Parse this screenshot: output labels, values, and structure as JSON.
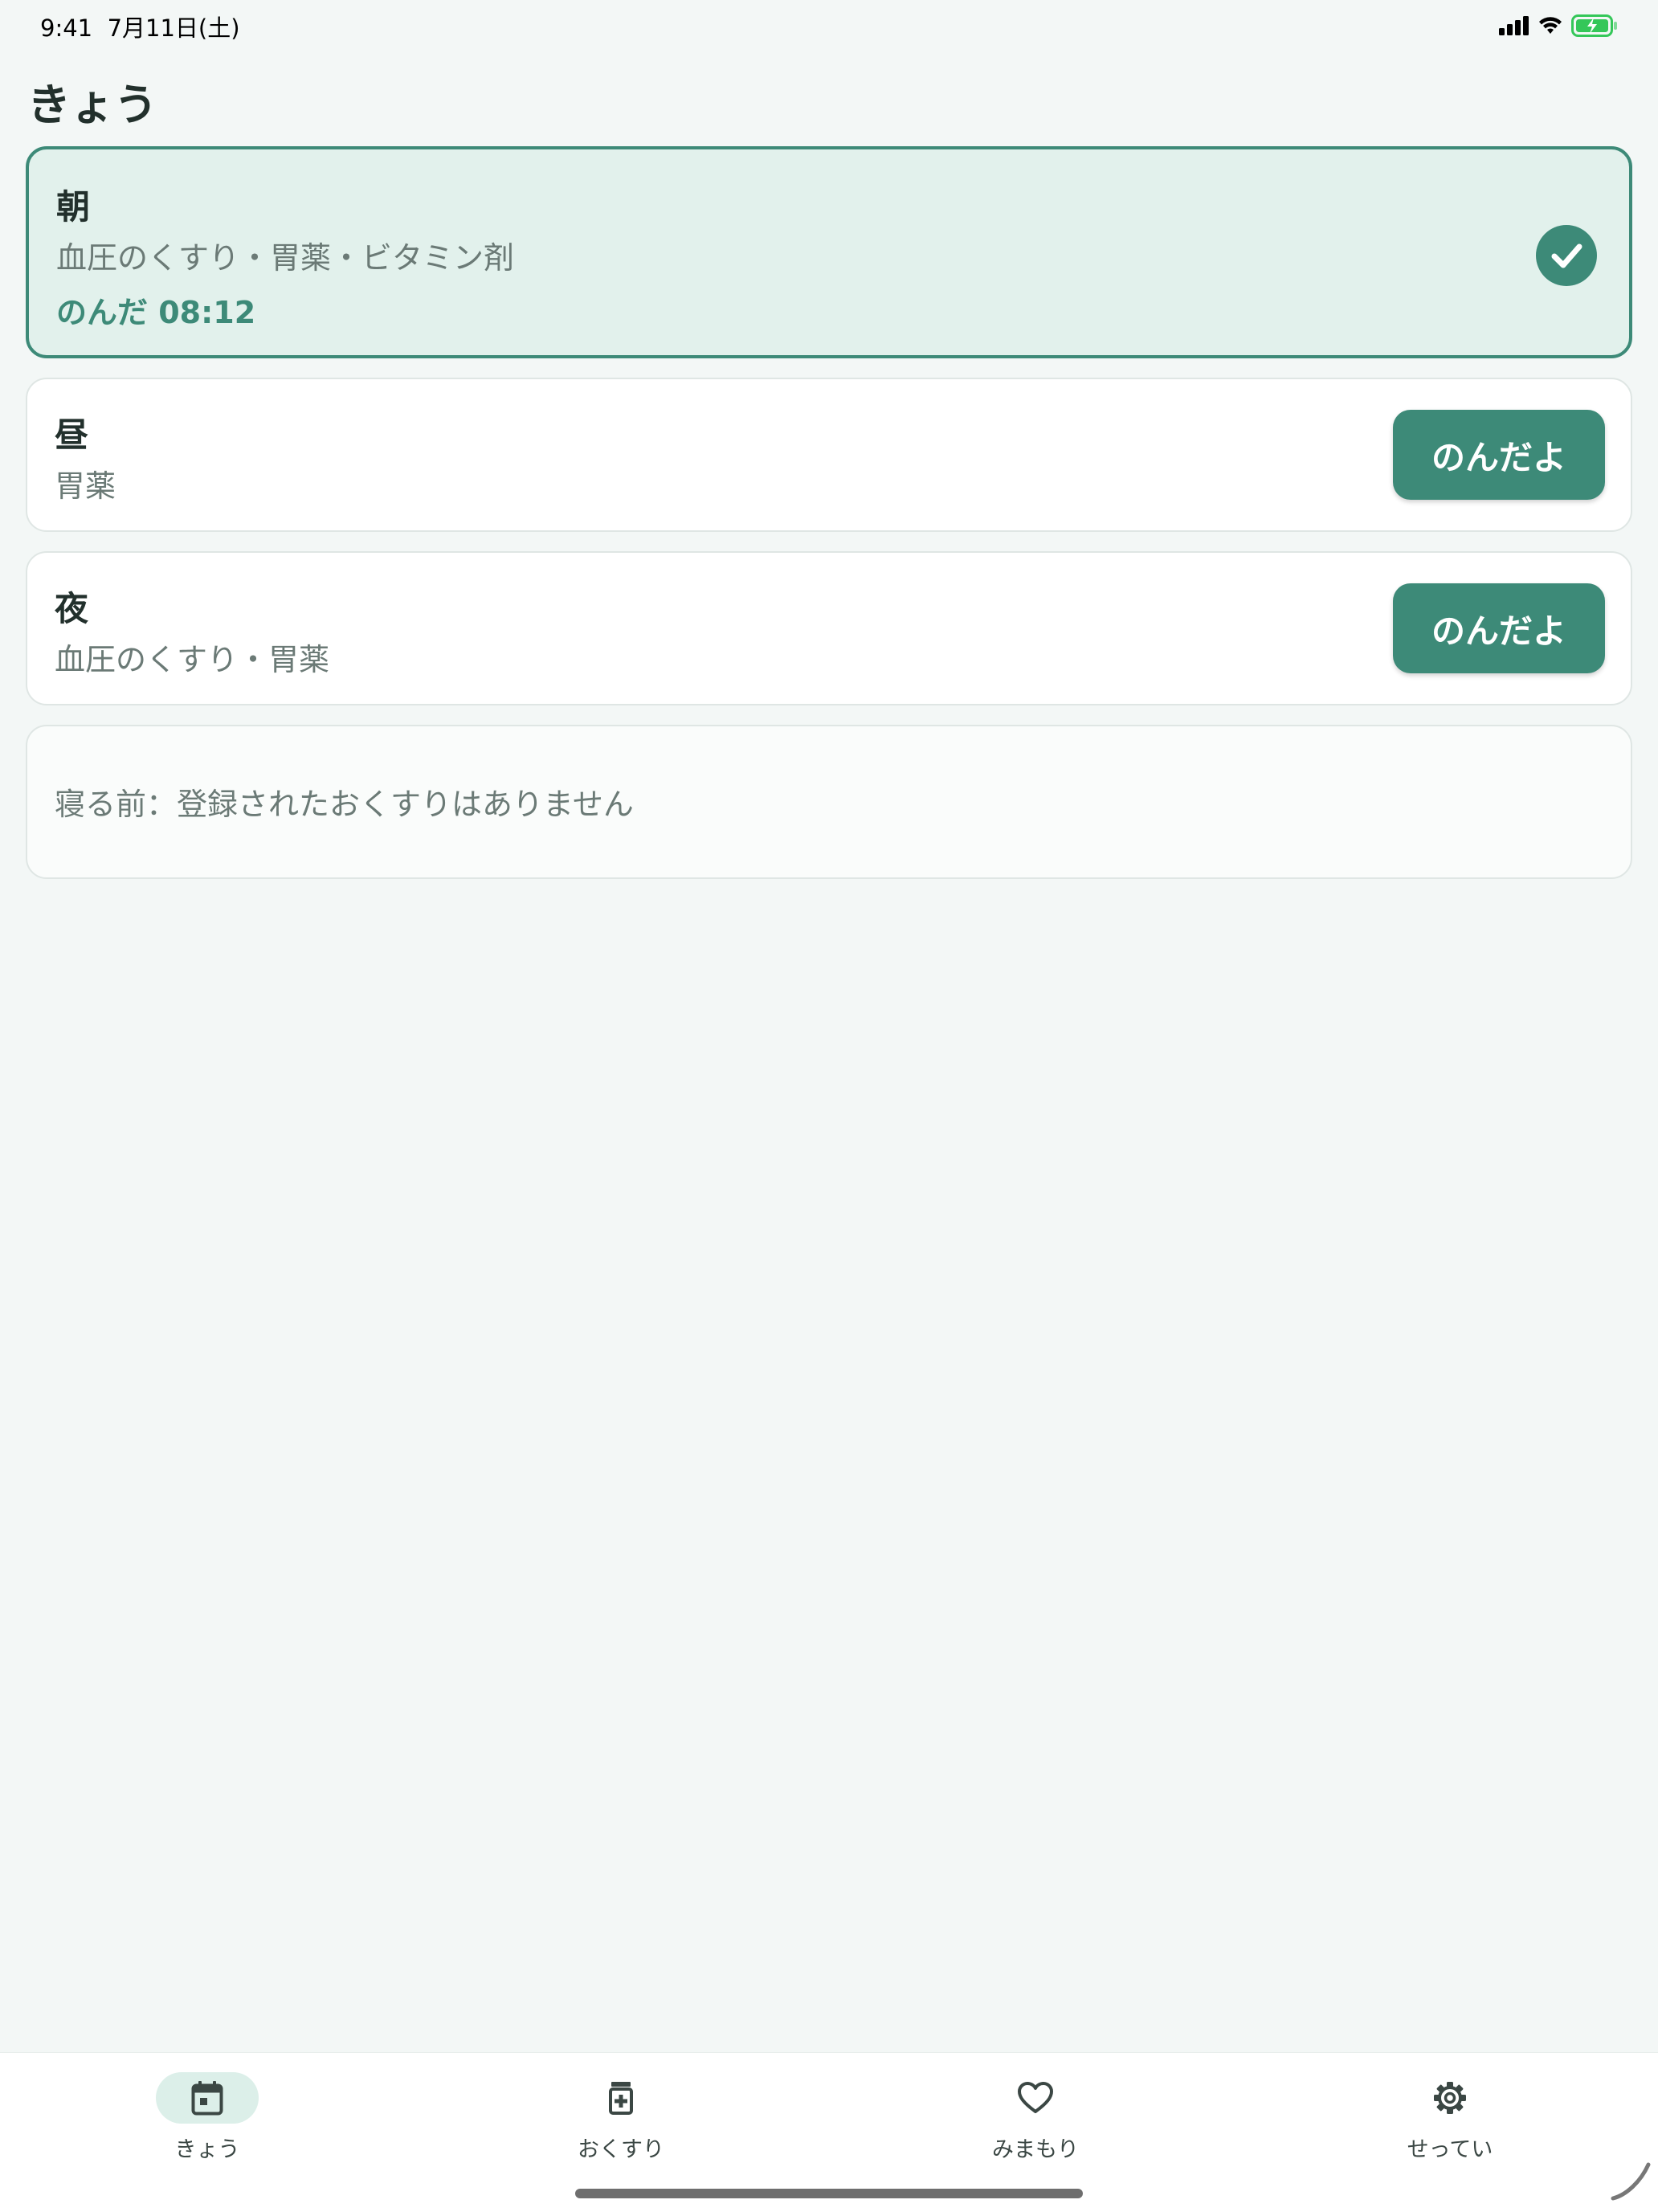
{
  "status_bar": {
    "time": "9:41",
    "date": "7月11日(土)",
    "icons": [
      "cellular-signal-icon",
      "wifi-icon",
      "battery-charging-icon"
    ],
    "battery_color": "#34c759"
  },
  "header": {
    "title": "きょう"
  },
  "colors": {
    "accent": "#3d8a78",
    "background": "#f3f7f6",
    "done_card_bg": "#e2f1ec"
  },
  "schedule": [
    {
      "slot": "朝",
      "meds": "血圧のくすり・胃薬・ビタミン剤",
      "status": "taken",
      "taken_text": "のんだ 08:12",
      "icon": "check-circle-icon"
    },
    {
      "slot": "昼",
      "meds": "胃薬",
      "status": "pending",
      "button_label": "のんだよ"
    },
    {
      "slot": "夜",
      "meds": "血圧のくすり・胃薬",
      "status": "pending",
      "button_label": "のんだよ"
    },
    {
      "slot": "寝る前",
      "status": "empty",
      "empty_text": "寝る前：登録されたおくすりはありません"
    }
  ],
  "tabs": [
    {
      "label": "きょう",
      "icon": "calendar-icon",
      "active": true
    },
    {
      "label": "おくすり",
      "icon": "medicine-bottle-icon",
      "active": false
    },
    {
      "label": "みまもり",
      "icon": "heart-icon",
      "active": false
    },
    {
      "label": "せってい",
      "icon": "gear-icon",
      "active": false
    }
  ]
}
